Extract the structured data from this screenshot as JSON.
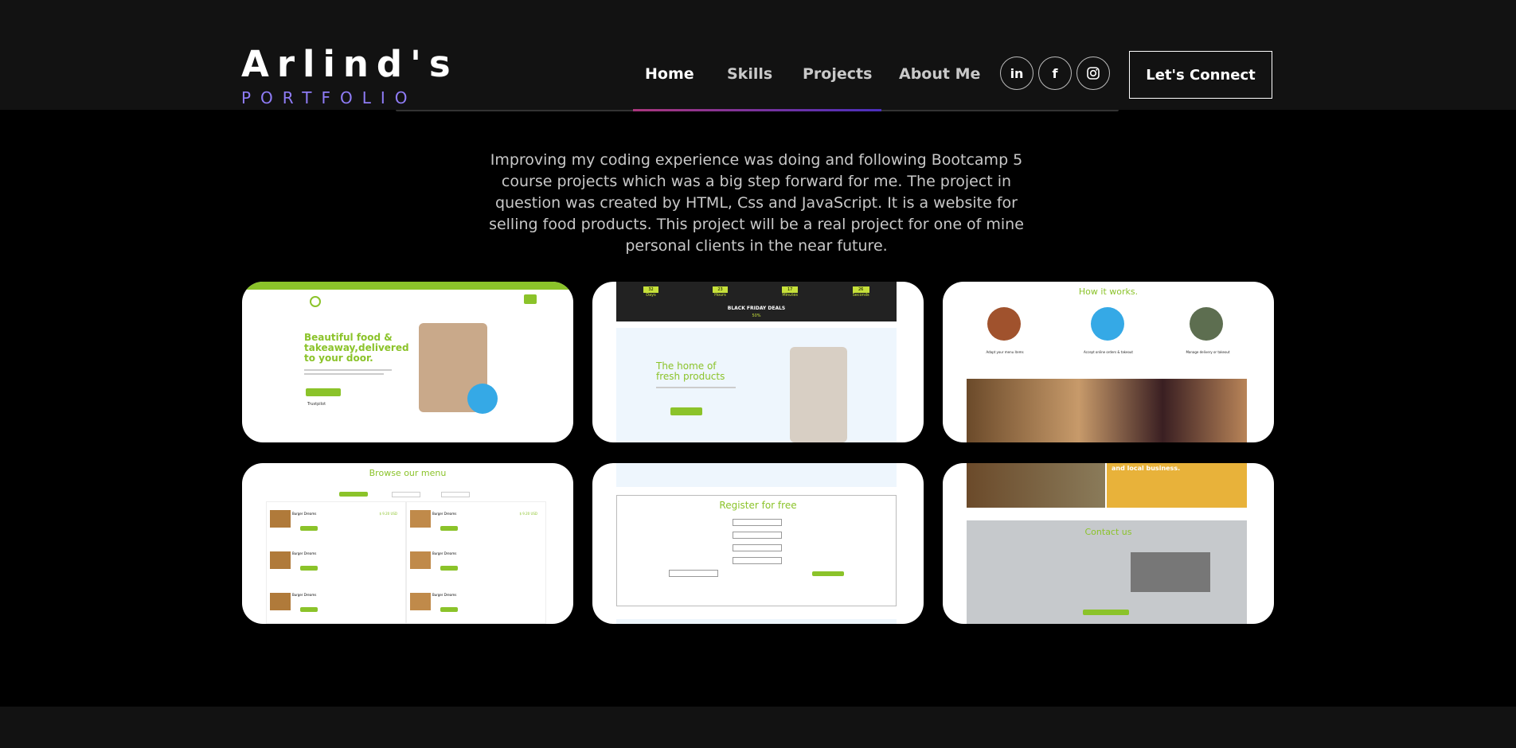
{
  "brand": {
    "title": "Arlind's",
    "subtitle": "PORTFOLIO"
  },
  "nav": {
    "home": "Home",
    "skills": "Skills",
    "projects": "Projects",
    "about": "About Me"
  },
  "social": {
    "linkedin": "in",
    "facebook": "f",
    "instagram_icon": "instagram-icon"
  },
  "connect_label": "Let's Connect",
  "description": "Improving my coding experience was doing and following Bootcamp 5 course projects which was a big step forward for me. The project in question was created by HTML, Css and JavaScript. It is a website for selling food products. This project will be a real project for one of mine personal clients in the near future.",
  "cards": {
    "c1": {
      "headline": "Beautiful food & takeaway,delivered to your door.",
      "rating": "Trustpilot"
    },
    "c2": {
      "banner": "BLACK FRIDAY DEALS",
      "headline": "The home of fresh products",
      "days": "32",
      "hours": "23",
      "minutes": "17",
      "seconds": "26",
      "days_l": "Days",
      "hours_l": "Hours",
      "minutes_l": "Minutes",
      "seconds_l": "Seconds",
      "promo": "50%"
    },
    "c3": {
      "headline": "How it works.",
      "s1": "Adapt your menu items",
      "s2": "Accept online orders & takeout",
      "s3": "Manage delivery or takeout"
    },
    "c4": {
      "headline": "Browse our menu",
      "item": "Burger Dreams",
      "price": "$ 9.20 USD"
    },
    "c5": {
      "headline": "Register for free"
    },
    "c6": {
      "top": "and local business.",
      "headline": "Contact us"
    }
  },
  "colors": {
    "accent": "#8bc32a",
    "brand_sub": "#8f7cf7",
    "nav_bg": "#121212"
  }
}
